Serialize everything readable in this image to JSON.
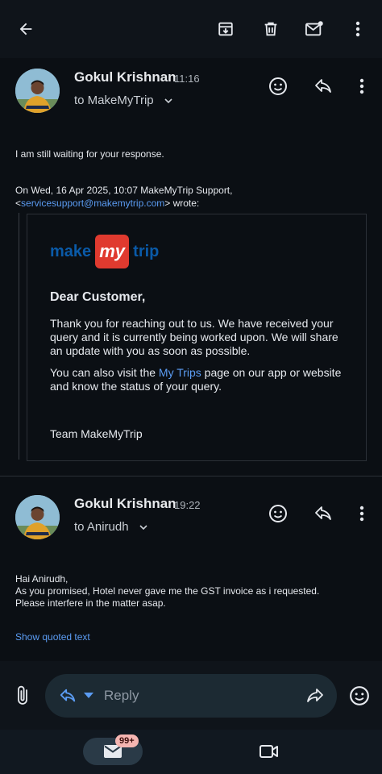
{
  "toolbar": {
    "back": "arrow-back-icon",
    "archive": "archive-icon",
    "delete": "trash-icon",
    "mark_unread": "mail-unread-icon",
    "more": "more-vert-icon"
  },
  "messages": [
    {
      "sender": "Gokul Krishnan",
      "time": "11:16",
      "recipient": "to MakeMyTrip",
      "body": "I am still waiting for your response.",
      "quote_header_line1": "On Wed, 16 Apr 2025, 10:07 MakeMyTrip Support,",
      "quote_header_open": "<",
      "quote_email": "servicesupport@makemytrip.com",
      "quote_header_close": "> wrote:",
      "quoted": {
        "logo_left": "make",
        "logo_mid": "my",
        "logo_right": "trip",
        "greeting": "Dear Customer,",
        "para1_line1": "Thank you for reaching out to us. We have received your",
        "para1_line2": "query and it is currently being worked upon. We will share",
        "para1_line3": "an update with you as soon as possible.",
        "para2_pre": "You can also visit the ",
        "para2_link": "My Trips",
        "para2_post": " page on our app or website",
        "para2_line2": "and know the status of your query.",
        "signoff": "Team MakeMyTrip"
      }
    },
    {
      "sender": "Gokul Krishnan",
      "time": "19:22",
      "recipient": "to Anirudh",
      "body_line1": "Hai Anirudh,",
      "body_line2": "As you promised, Hotel never gave me the GST invoice as i requested.",
      "body_line3": "Please interfere in the matter asap.",
      "show_quoted": "Show quoted text"
    }
  ],
  "reply_bar": {
    "placeholder": "Reply"
  },
  "nav": {
    "mail_badge": "99+"
  },
  "colors": {
    "accent_link": "#5b9cf3",
    "brand_red": "#e03a2f",
    "brand_blue": "#0a5aa8",
    "badge_bg": "#f5b5b1"
  }
}
